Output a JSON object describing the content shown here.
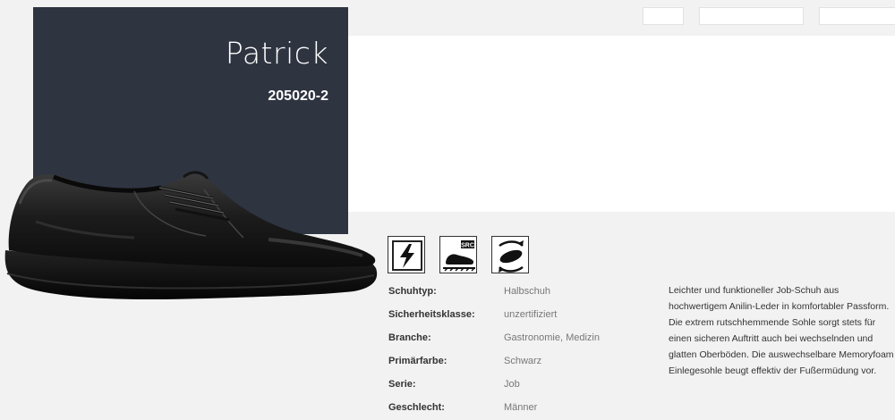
{
  "product": {
    "name": "Patrick",
    "number": "205020-2"
  },
  "feature_icons": [
    {
      "icon": "esd-lightning-icon"
    },
    {
      "icon": "src-slip-resistance-icon",
      "label": "SRC"
    },
    {
      "icon": "replaceable-insole-icon"
    }
  ],
  "specs": [
    {
      "label": "Schuhtyp:",
      "value": "Halbschuh"
    },
    {
      "label": "Sicherheitsklasse:",
      "value": "unzertifiziert"
    },
    {
      "label": "Branche:",
      "value": "Gastronomie, Medizin"
    },
    {
      "label": "Primärfarbe:",
      "value": "Schwarz"
    },
    {
      "label": "Serie:",
      "value": "Job"
    },
    {
      "label": "Geschlecht:",
      "value": "Männer"
    }
  ],
  "description": "Leichter und funktioneller Job-Schuh aus hochwertigem Anilin-Leder in komfortabler Passform. Die extrem rutschhemmende Sohle sorgt stets für einen sicheren Auftritt auch bei wechselnden und glatten Oberböden. Die auswechselbare Memoryfoam Einlegesohle beugt effektiv der Fußermüdung vor.",
  "colors": {
    "dark_panel": "#2f3441",
    "background": "#f2f2f2"
  }
}
